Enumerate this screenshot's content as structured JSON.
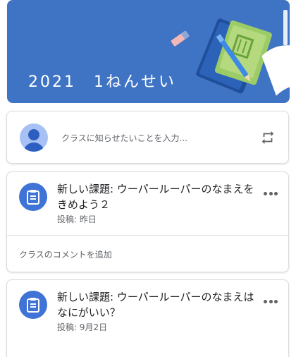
{
  "banner": {
    "title": "2021　1ねんせい",
    "color": "#3f73c4"
  },
  "announce": {
    "placeholder": "クラスに知らせたいことを入力..."
  },
  "posts": [
    {
      "title": "新しい課題: ウーパールーパーのなまえをきめよう２",
      "date": "投稿: 昨日",
      "comment_placeholder": "クラスのコメントを追加"
    },
    {
      "title": "新しい課題: ウーパールーパーのなまえはなにがいい？",
      "date": "投稿: 9月2日"
    }
  ],
  "icons": {
    "avatar": "user-avatar-icon",
    "repost": "repost-icon",
    "assignment": "assignment-icon",
    "more": "more-horiz-icon"
  },
  "colors": {
    "accent": "#3f73d6",
    "muted_text": "#5f6368"
  }
}
